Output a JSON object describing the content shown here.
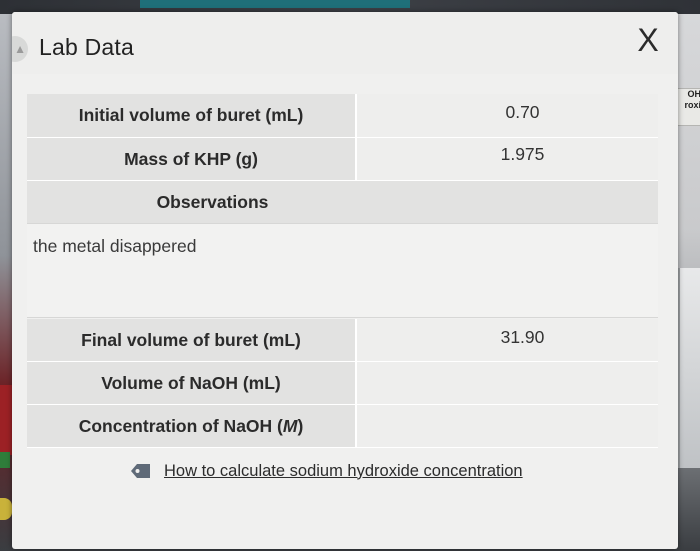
{
  "background": {
    "bottle_label_line1": "OH",
    "bottle_label_line2": "roxi"
  },
  "dialog": {
    "title": "Lab Data",
    "close_label": "X",
    "flask_icon": "flask-icon"
  },
  "table": {
    "rows_top": [
      {
        "label": "Initial volume of buret (mL)",
        "value": "0.70"
      },
      {
        "label": "Mass of KHP (g)",
        "value": "1.975"
      }
    ],
    "observations_label": "Observations",
    "observations_text": "the metal disappered",
    "rows_bottom": [
      {
        "label": "Final volume of buret (mL)",
        "value": "31.90"
      },
      {
        "label": "Volume of NaOH (mL)",
        "value": ""
      },
      {
        "label": "Concentration of NaOH (",
        "label_italic": "M",
        "label_end": ")",
        "value": ""
      }
    ]
  },
  "help": {
    "icon": "tag-icon",
    "link_text": "How to calculate sodium hydroxide concentration"
  },
  "colors": {
    "dialog_bg": "#f0f0ef",
    "label_cell_bg": "#e2e2e1",
    "value_cell_bg": "#eeeeed",
    "tag_icon": "#5f6a78"
  }
}
